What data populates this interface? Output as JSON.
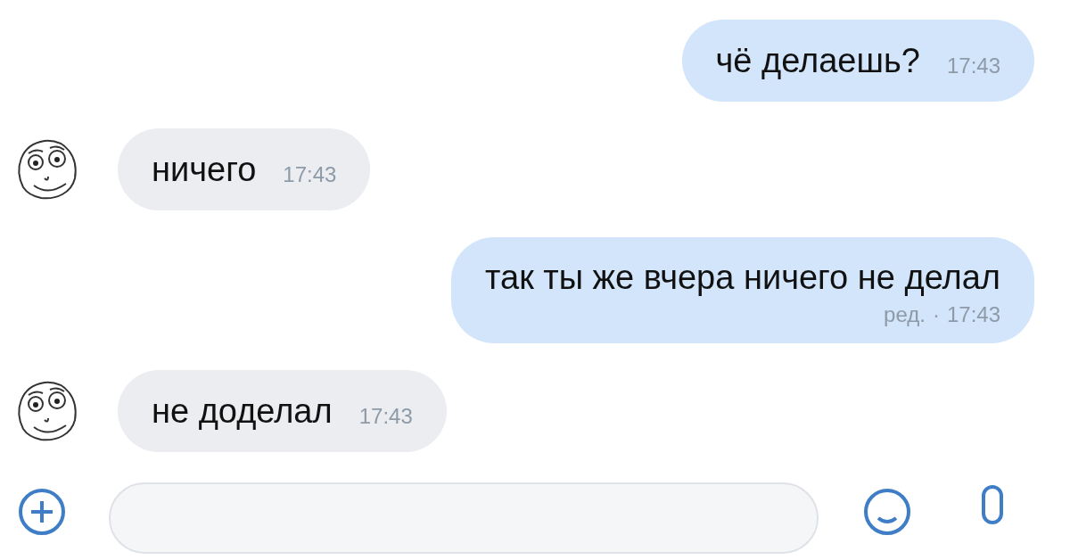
{
  "messages": [
    {
      "kind": "out",
      "text": "чё делаешь?",
      "time": "17:43"
    },
    {
      "kind": "in",
      "text": "ничего",
      "time": "17:43"
    },
    {
      "kind": "out",
      "text": "так ты же вчера ничего не делал",
      "edited": "ред.",
      "separator": "·",
      "time": "17:43"
    },
    {
      "kind": "in",
      "text": "не доделал",
      "time": "17:43"
    }
  ]
}
